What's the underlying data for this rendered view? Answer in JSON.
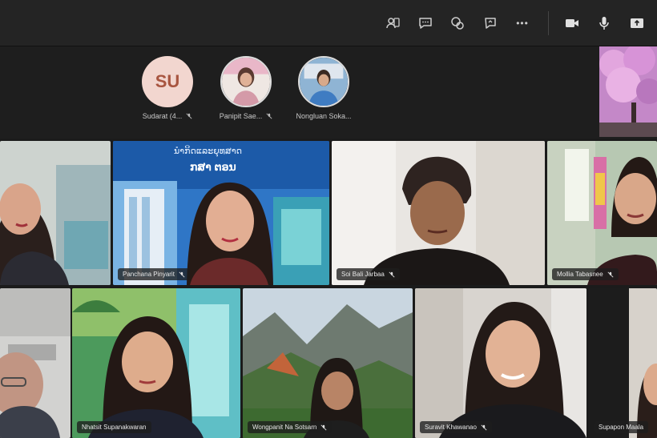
{
  "toolbar": {
    "buttons": [
      {
        "name": "participants-icon"
      },
      {
        "name": "chat-icon"
      },
      {
        "name": "reactions-icon"
      },
      {
        "name": "share-icon"
      },
      {
        "name": "more-icon",
        "label": "•••"
      },
      {
        "name": "camera-icon"
      },
      {
        "name": "microphone-icon"
      },
      {
        "name": "share-screen-icon"
      }
    ]
  },
  "roster": [
    {
      "initials": "SU",
      "name": "Sudarat (4...",
      "muted": true
    },
    {
      "initials": "",
      "name": "Panipit Sae...",
      "muted": true
    },
    {
      "initials": "",
      "name": "Nongluan Soka...",
      "muted": false
    }
  ],
  "tiles": [
    {
      "name": "",
      "muted": false
    },
    {
      "name": "Panchana Pinyarit",
      "muted": true,
      "banner": "ນຳກິດແລະຍຸທສາດ",
      "banner2": "ກສາ ຕອນ"
    },
    {
      "name": "Soi Bali Jarbaa",
      "muted": true
    },
    {
      "name": "Mollia Tabasnee",
      "muted": true
    },
    {
      "name": "",
      "muted": false
    },
    {
      "name": "Nhatsit Supanakwaran",
      "muted": false,
      "speaking": true
    },
    {
      "name": "Wongpanit Na Sotsarn",
      "muted": true
    },
    {
      "name": "Suravit Khawanao",
      "muted": true
    },
    {
      "name": "Supapon Maala",
      "muted": false
    }
  ],
  "colors": {
    "background": "#1b1b1b",
    "toolbar": "#242424",
    "speaking_outline": "#8b8fd6",
    "avatar_initials_bg": "#f2d6cf"
  }
}
